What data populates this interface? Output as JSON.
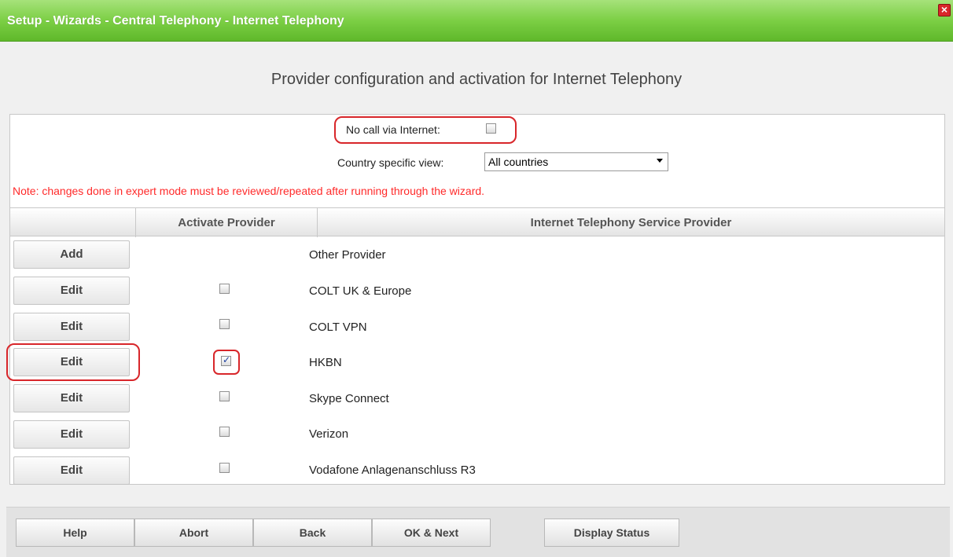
{
  "window": {
    "title": "Setup - Wizards - Central Telephony - Internet Telephony",
    "close_icon": "close-icon"
  },
  "page": {
    "heading": "Provider configuration and activation for Internet Telephony",
    "no_call_label": "No call via Internet:",
    "no_call_checked": false,
    "country_label": "Country specific view:",
    "country_value": "All countries",
    "note": "Note: changes done in expert mode must be reviewed/repeated after running through the wizard."
  },
  "table": {
    "headers": [
      "",
      "Activate Provider",
      "Internet Telephony Service Provider"
    ],
    "rows": [
      {
        "button": "Add",
        "checkbox": null,
        "provider": "Other Provider"
      },
      {
        "button": "Edit",
        "checkbox": false,
        "provider": "COLT UK & Europe"
      },
      {
        "button": "Edit",
        "checkbox": false,
        "provider": "COLT VPN"
      },
      {
        "button": "Edit",
        "checkbox": true,
        "provider": "HKBN"
      },
      {
        "button": "Edit",
        "checkbox": false,
        "provider": "Skype Connect"
      },
      {
        "button": "Edit",
        "checkbox": false,
        "provider": "Verizon"
      },
      {
        "button": "Edit",
        "checkbox": false,
        "provider": "Vodafone Anlagenanschluss R3"
      }
    ]
  },
  "footer": {
    "help": "Help",
    "abort": "Abort",
    "back": "Back",
    "ok_next": "OK & Next",
    "display_status": "Display Status"
  },
  "colors": {
    "titlebar": "#7ccf45",
    "note": "#ff2a2a",
    "highlight": "#d8262a"
  }
}
